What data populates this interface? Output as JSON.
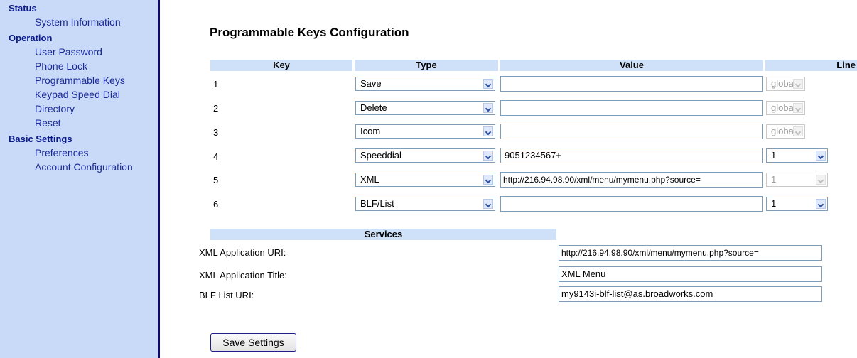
{
  "sidebar": {
    "sections": [
      {
        "label": "Status",
        "items": [
          "System Information"
        ]
      },
      {
        "label": "Operation",
        "items": [
          "User Password",
          "Phone Lock",
          "Programmable Keys",
          "Keypad Speed Dial",
          "Directory",
          "Reset"
        ]
      },
      {
        "label": "Basic Settings",
        "items": [
          "Preferences",
          "Account Configuration"
        ]
      }
    ]
  },
  "page": {
    "title": "Programmable Keys Configuration"
  },
  "table": {
    "headers": {
      "key": "Key",
      "type": "Type",
      "value": "Value",
      "line": "Line"
    },
    "rows": [
      {
        "key": "1",
        "type": "Save",
        "value": "",
        "line": "global",
        "line_disabled": true
      },
      {
        "key": "2",
        "type": "Delete",
        "value": "",
        "line": "global",
        "line_disabled": true
      },
      {
        "key": "3",
        "type": "Icom",
        "value": "",
        "line": "global",
        "line_disabled": true
      },
      {
        "key": "4",
        "type": "Speeddial",
        "value": "9051234567+",
        "line": "1",
        "line_disabled": false
      },
      {
        "key": "5",
        "type": "XML",
        "value": "http://216.94.98.90/xml/menu/mymenu.php?source=",
        "line": "1",
        "line_disabled": true
      },
      {
        "key": "6",
        "type": "BLF/List",
        "value": "",
        "line": "1",
        "line_disabled": false
      }
    ]
  },
  "services": {
    "header": "Services",
    "xml_uri_label": "XML Application URI:",
    "xml_uri_value": "http://216.94.98.90/xml/menu/mymenu.php?source=",
    "xml_title_label": "XML Application Title:",
    "xml_title_value": "XML Menu",
    "blf_label": "BLF List URI:",
    "blf_value": "my9143i-blf-list@as.broadworks.com"
  },
  "actions": {
    "save_label": "Save Settings"
  }
}
